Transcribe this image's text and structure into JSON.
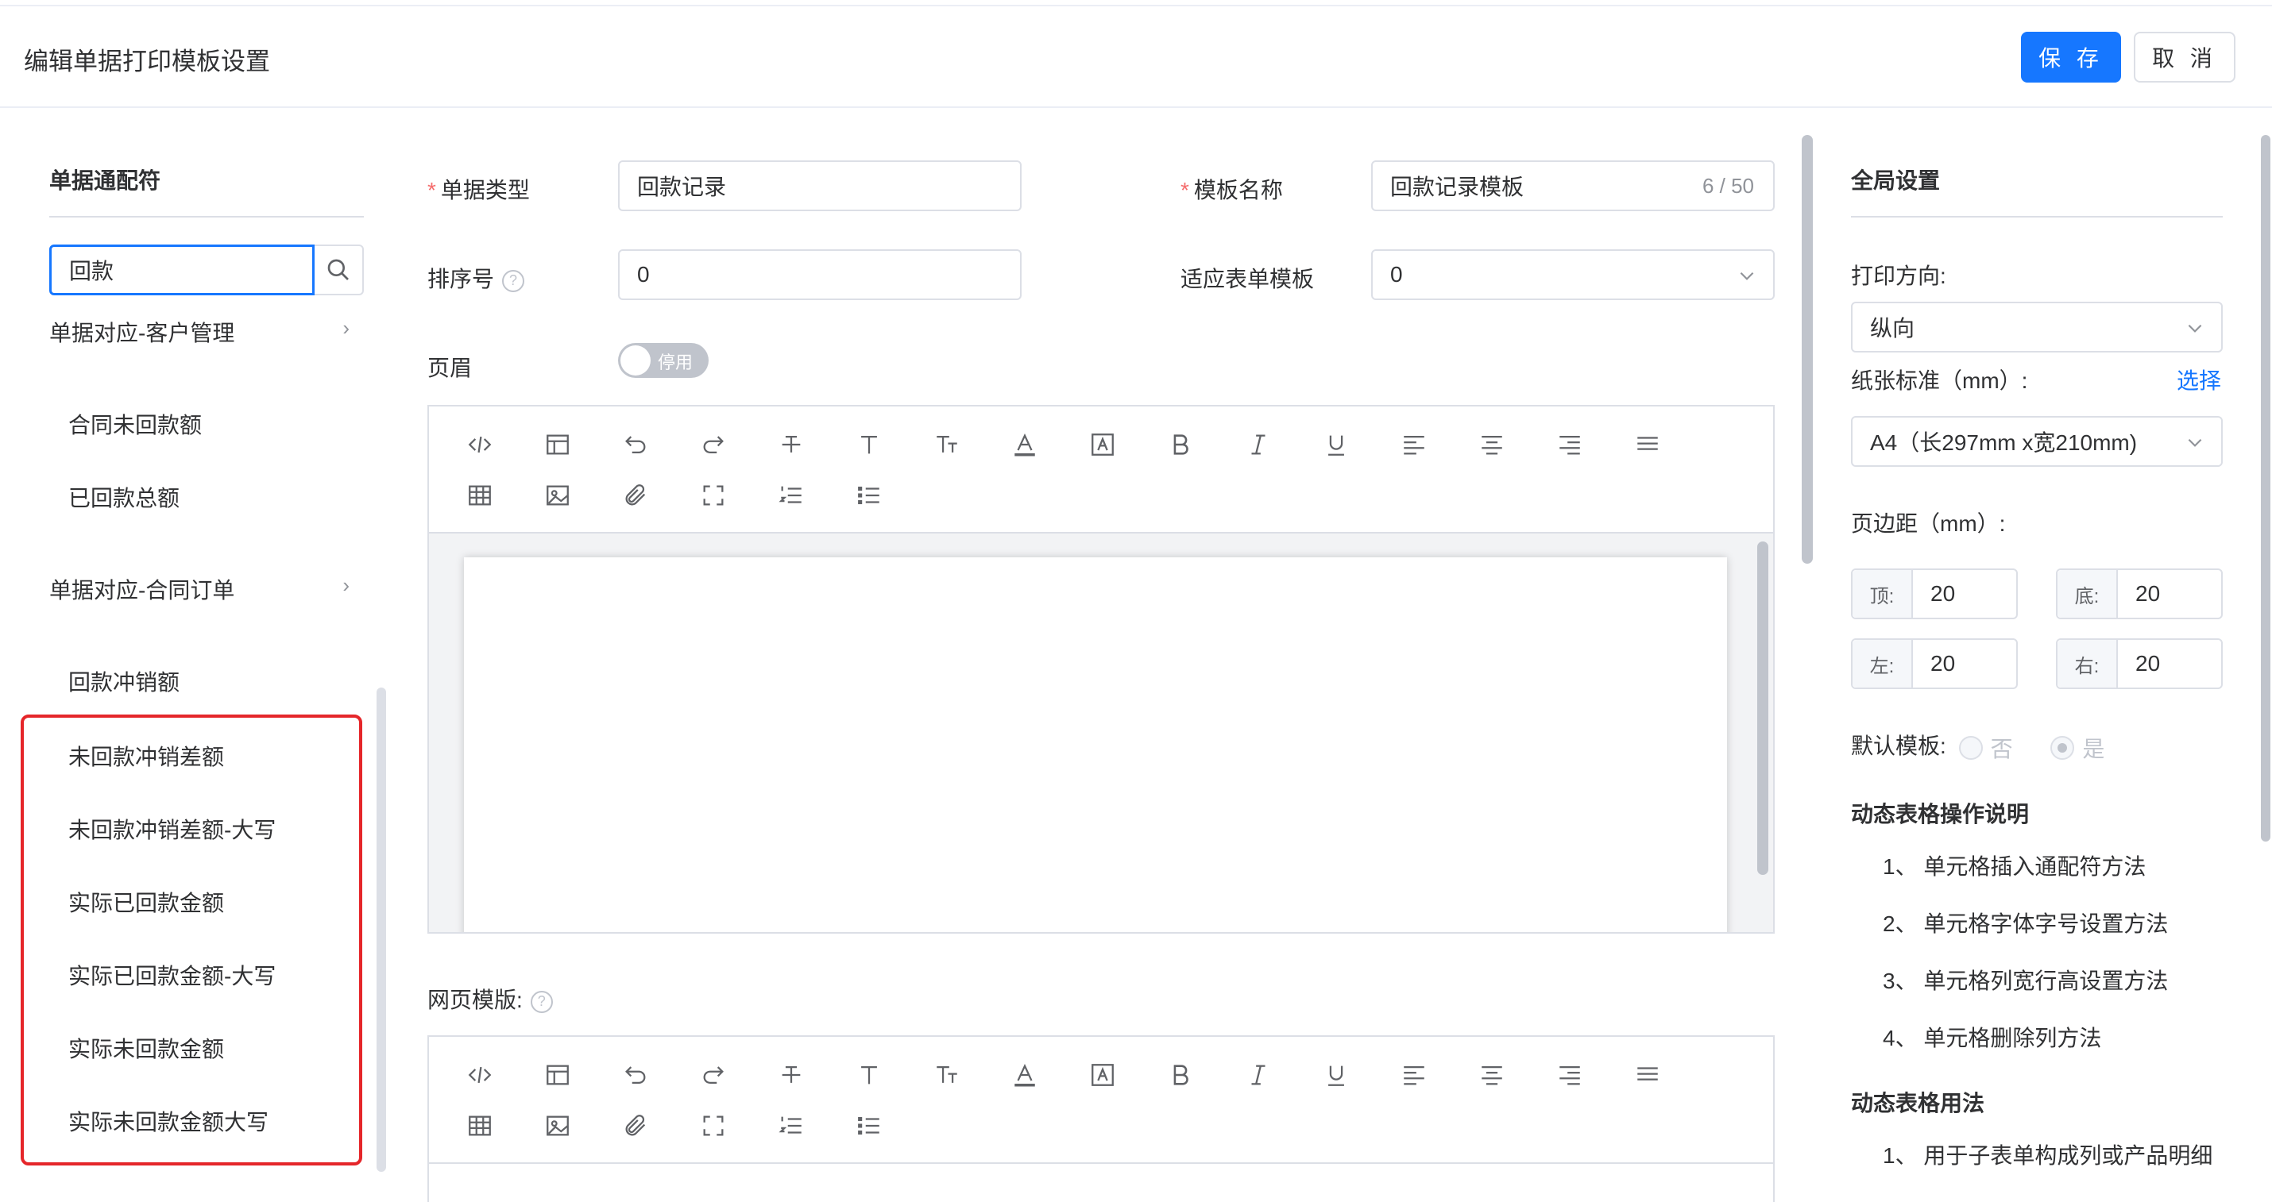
{
  "header": {
    "title": "编辑单据打印模板设置",
    "save_label": "保 存",
    "cancel_label": "取 消"
  },
  "left": {
    "title": "单据通配符",
    "search_value": "回款",
    "groups": [
      {
        "label": "单据对应-客户管理",
        "items": [
          "合同未回款额",
          "已回款总额"
        ]
      },
      {
        "label": "单据对应-合同订单",
        "items": [
          "回款冲销额",
          "未回款冲销差额",
          "未回款冲销差额-大写",
          "实际已回款金额",
          "实际已回款金额-大写",
          "实际未回款金额",
          "实际未回款金额大写"
        ]
      }
    ]
  },
  "form": {
    "doc_type_label": "单据类型",
    "doc_type_value": "回款记录",
    "template_name_label": "模板名称",
    "template_name_value": "回款记录模板",
    "template_name_count": "6 / 50",
    "sort_label": "排序号",
    "sort_value": "0",
    "form_template_label": "适应表单模板",
    "form_template_value": "0",
    "header_label": "页眉",
    "header_toggle": "停用",
    "web_template_label": "网页模版:"
  },
  "right": {
    "title": "全局设置",
    "orientation_label": "打印方向:",
    "orientation_value": "纵向",
    "paper_label": "纸张标准（mm）:",
    "paper_link": "选择",
    "paper_value": "A4（长297mm x宽210mm)",
    "margin_label": "页边距（mm）:",
    "margins": {
      "top_label": "顶:",
      "top": "20",
      "bottom_label": "底:",
      "bottom": "20",
      "left_label": "左:",
      "left": "20",
      "right_label": "右:",
      "right": "20"
    },
    "default_label": "默认模板:",
    "default_no": "否",
    "default_yes": "是",
    "ops_title": "动态表格操作说明",
    "ops_items": [
      "1、 单元格插入通配符方法",
      "2、 单元格字体字号设置方法",
      "3、 单元格列宽行高设置方法",
      "4、 单元格删除列方法"
    ],
    "usage_title": "动态表格用法",
    "usage_items": [
      "1、 用于子表单构成列或产品明细"
    ]
  },
  "colors": {
    "primary": "#1677ff",
    "highlight": "#e5262a",
    "border": "#dcdfe6"
  }
}
